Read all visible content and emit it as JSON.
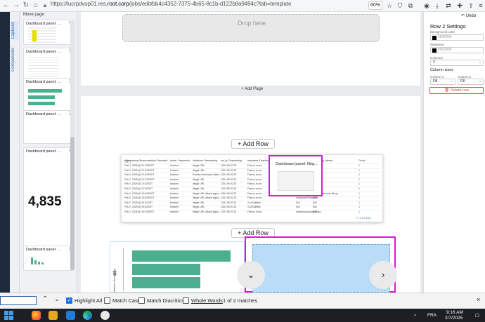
{
  "browser": {
    "url_prefix": "https://lucrpdvop01.res.",
    "url_domain": "root.corp",
    "url_suffix": "/jobs/edit/bb4c4352-7375-4b65-8c1b-d122b8a9494c?tab=template",
    "zoom": "60%",
    "undo_label": "Undo"
  },
  "left_panel": {
    "header": "Move page",
    "tabs": [
      "Captures",
      "Components"
    ],
    "cards": [
      {
        "title": "Dashboard panel: ..."
      },
      {
        "title": "Dashboard panel: ..."
      },
      {
        "title": "Dashboard panel: ..."
      },
      {
        "title": "Dashboard panel: ..."
      },
      {
        "title": "Dashboard panel: ..."
      },
      {
        "title": "Dashboard panel: ..."
      }
    ],
    "big_number": "4,835"
  },
  "canvas": {
    "drop_here": "Drop here",
    "add_page": "Add Page",
    "add_row": "Add Row",
    "popup_title": "Dashboard panel: Illeg...",
    "table_headers": [
      "@timestamp Descen...",
      "method: Descendi...",
      "action: Descendin...",
      "violations: Descending",
      "src_ip: Descending",
      "hostname: Descending",
      "",
      "User Des...",
      "attack_sig_names...",
      "Count"
    ],
    "table_rows": [
      [
        "Feb 2, 2025 @ 21:21:...",
        "POST",
        "blocked",
        "Illegal URL",
        "128.199.20.32",
        "Franco.eu.eu",
        "",
        "N/A",
        "N/A",
        "1"
      ],
      [
        "Feb 2, 2025 @ 21:21:...",
        "POST",
        "blocked",
        "Illegal URL",
        "128.199.20.32",
        "Franco.eu.eu",
        "",
        "N/A",
        "N/A",
        "1"
      ],
      [
        "Feb 2, 2025 @ 21:21:...",
        "POST",
        "blocked",
        "Evasion technique detec...",
        "128.199.20.32",
        "Franco.eu.eu",
        "",
        "N/A",
        "N/A",
        "1"
      ],
      [
        "Feb 2, 2025 @ 21:21:...",
        "POST",
        "blocked",
        "Illegal URL",
        "128.199.20.32",
        "Franco.eu.eu",
        "",
        "N/A",
        "N/A",
        "1"
      ],
      [
        "Feb 2, 2025 @ 21:02:...",
        "GET",
        "blocked",
        "Illegal URL",
        "128.199.20.32",
        "Franco.eu.eu",
        "",
        "N/A",
        "N/A",
        "1"
      ],
      [
        "Feb 2, 2025 @ 21:02:...",
        "GET",
        "blocked",
        "Illegal URL",
        "128.199.20.32",
        "Franco.eu.eu",
        "",
        "N/A",
        "N/A",
        "1"
      ],
      [
        "Feb 2, 2025 @ 10:01:...",
        "POST",
        "blocked",
        "Illegal URL,Attack signa...",
        "128.199.20.32",
        "Franco.eu.eu",
        "",
        "N/A",
        "Executable code file up...",
        "1"
      ],
      [
        "Feb 2, 2025 @ 10:01:...",
        "POST",
        "blocked",
        "Illegal URL,Attack signa...",
        "128.199.20.32",
        "Franco.eu.eu",
        "",
        "/employee/ReportTe...",
        "N/A",
        "1"
      ],
      [
        "Feb 2, 2025 @ 10:01:...",
        "GET",
        "blocked",
        "Illegal URL",
        "128.199.20.32",
        "/Co/Satellite",
        "",
        "N/A",
        "N/A",
        "1"
      ],
      [
        "Feb 2, 2025 @ 10:02:...",
        "GET",
        "blocked",
        "Illegal URL",
        "128.199.20.32",
        "/Co/Satellite",
        "",
        "N/A",
        "N/A",
        "1"
      ],
      [
        "Feb 2, 2025 @ 10:01:...",
        "POST",
        "blocked",
        "Illegal URL,Attack signa...",
        "128.199.20.32",
        "Franco.eu.eu",
        "",
        "/passlong.successfulla...",
        "N/A",
        "1"
      ]
    ],
    "pagination": "< 1 2 3 4 5 6 >",
    "bar_chart_ylabel": "violations: Descending"
  },
  "chart_data": {
    "type": "bar",
    "orientation": "horizontal",
    "categories": [
      "",
      "",
      ""
    ],
    "values": [
      92,
      64,
      64
    ],
    "xlim": [
      0,
      100
    ]
  },
  "right_panel": {
    "title": "Row 2 Settings",
    "background_label": "Background color",
    "background_value": "#000000",
    "separator_label": "Separator",
    "separator_value": "#000000",
    "columns_label": "Columns",
    "columns_value": "2",
    "column_sizes_label": "Column sizes",
    "column1_label": "Column 1",
    "column1_value": "Fill",
    "column2_label": "Column 2",
    "column2_value": "Fill",
    "delete_label": "Delete row"
  },
  "find_bar": {
    "highlight_all": "Highlight All",
    "match_case": "Match Case",
    "match_diacritics": "Match Diacritics",
    "whole_words": "Whole Words",
    "status": "1 of 2 matches"
  },
  "taskbar": {
    "time": "9:16 AM",
    "date": "2/7/2025",
    "lang": "FRA"
  },
  "colors": {
    "accent": "#2b5fa8",
    "selection": "#d41ad1",
    "bar": "#4caf8f",
    "drop_target": "#b9dcf7"
  }
}
